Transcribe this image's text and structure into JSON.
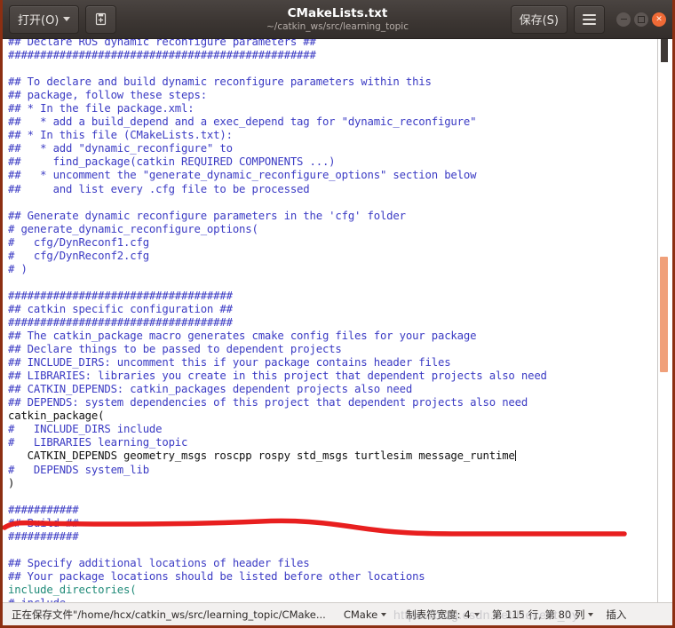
{
  "window": {
    "title": "CMakeLists.txt",
    "subtitle": "~/catkin_ws/src/learning_topic",
    "open_button": "打开(O)",
    "save_button": "保存(S)",
    "new_document_icon": "new-document-icon",
    "menu_icon": "hamburger-menu-icon",
    "minimize_icon": "minimize-icon",
    "maximize_icon": "maximize-icon",
    "close_icon": "close-icon"
  },
  "editor": {
    "language": "CMake",
    "lines": [
      {
        "text": "## Declare ROS dynamic reconfigure parameters ##",
        "style": "cmt"
      },
      {
        "text": "################################################",
        "style": "cmt"
      },
      {
        "text": "",
        "style": "cmt"
      },
      {
        "text": "## To declare and build dynamic reconfigure parameters within this",
        "style": "cmt"
      },
      {
        "text": "## package, follow these steps:",
        "style": "cmt"
      },
      {
        "text": "## * In the file package.xml:",
        "style": "cmt"
      },
      {
        "text": "##   * add a build_depend and a exec_depend tag for \"dynamic_reconfigure\"",
        "style": "cmt"
      },
      {
        "text": "## * In this file (CMakeLists.txt):",
        "style": "cmt"
      },
      {
        "text": "##   * add \"dynamic_reconfigure\" to",
        "style": "cmt"
      },
      {
        "text": "##     find_package(catkin REQUIRED COMPONENTS ...)",
        "style": "cmt"
      },
      {
        "text": "##   * uncomment the \"generate_dynamic_reconfigure_options\" section below",
        "style": "cmt"
      },
      {
        "text": "##     and list every .cfg file to be processed",
        "style": "cmt"
      },
      {
        "text": "",
        "style": "cmt"
      },
      {
        "text": "## Generate dynamic reconfigure parameters in the 'cfg' folder",
        "style": "cmt"
      },
      {
        "text": "# generate_dynamic_reconfigure_options(",
        "style": "cmt"
      },
      {
        "text": "#   cfg/DynReconf1.cfg",
        "style": "cmt"
      },
      {
        "text": "#   cfg/DynReconf2.cfg",
        "style": "cmt"
      },
      {
        "text": "# )",
        "style": "cmt"
      },
      {
        "text": "",
        "style": "cmt"
      },
      {
        "text": "###################################",
        "style": "cmt"
      },
      {
        "text": "## catkin specific configuration ##",
        "style": "cmt"
      },
      {
        "text": "###################################",
        "style": "cmt"
      },
      {
        "text": "## The catkin_package macro generates cmake config files for your package",
        "style": "cmt"
      },
      {
        "text": "## Declare things to be passed to dependent projects",
        "style": "cmt"
      },
      {
        "text": "## INCLUDE_DIRS: uncomment this if your package contains header files",
        "style": "cmt"
      },
      {
        "text": "## LIBRARIES: libraries you create in this project that dependent projects also need",
        "style": "cmt"
      },
      {
        "text": "## CATKIN_DEPENDS: catkin_packages dependent projects also need",
        "style": "cmt"
      },
      {
        "text": "## DEPENDS: system dependencies of this project that dependent projects also need",
        "style": "cmt"
      },
      {
        "text": "catkin_package(",
        "style": "plain"
      },
      {
        "text": "#   INCLUDE_DIRS include",
        "style": "cmt"
      },
      {
        "text": "#   LIBRARIES learning_topic",
        "style": "cmt"
      },
      {
        "text": "   CATKIN_DEPENDS geometry_msgs roscpp rospy std_msgs turtlesim message_runtime",
        "style": "plain",
        "cursor_end": true
      },
      {
        "text": "#   DEPENDS system_lib",
        "style": "cmt"
      },
      {
        "text": ")",
        "style": "plain"
      },
      {
        "text": "",
        "style": "cmt"
      },
      {
        "text": "###########",
        "style": "cmt"
      },
      {
        "text": "## Build ##",
        "style": "cmt"
      },
      {
        "text": "###########",
        "style": "cmt"
      },
      {
        "text": "",
        "style": "cmt"
      },
      {
        "text": "## Specify additional locations of header files",
        "style": "cmt"
      },
      {
        "text": "## Your package locations should be listed before other locations",
        "style": "cmt"
      },
      {
        "text": "include_directories(",
        "style": "fn"
      },
      {
        "text": "# include",
        "style": "cmt"
      }
    ],
    "annotation": {
      "name": "red-underline-annotation",
      "color": "#e81f1f"
    },
    "scrollbar": {
      "name": "vertical-scrollbar",
      "thumb_color": "#f0a07a"
    }
  },
  "statusbar": {
    "file_status": "正在保存文件\"/home/hcx/catkin_ws/src/learning_topic/CMake...",
    "language": "CMake",
    "tab_label": "制表符宽度:",
    "tab_width": "4",
    "position": "第 115 行, 第 80 列",
    "insert_mode": "插入"
  },
  "watermark": "https://blog.csdn.net/Hecent_hy"
}
